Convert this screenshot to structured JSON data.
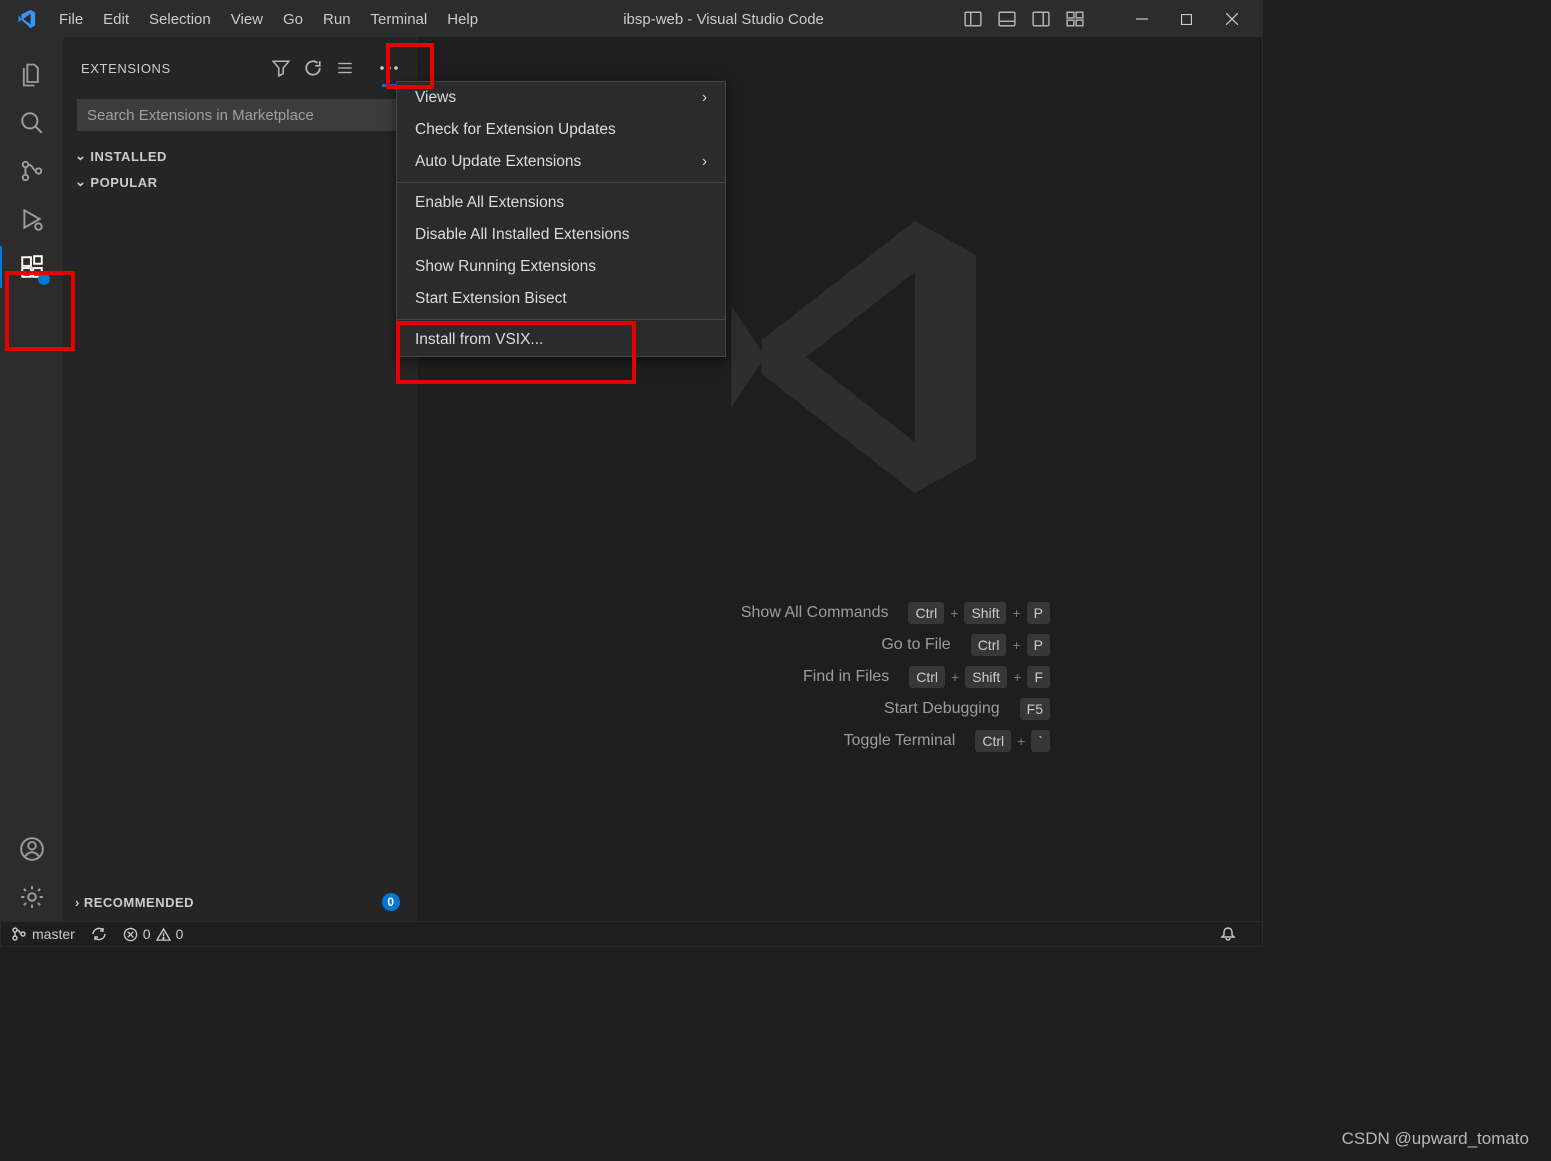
{
  "titlebar": {
    "menu": [
      "File",
      "Edit",
      "Selection",
      "View",
      "Go",
      "Run",
      "Terminal",
      "Help"
    ],
    "title": "ibsp-web - Visual Studio Code"
  },
  "sidepanel": {
    "title": "EXTENSIONS",
    "search_placeholder": "Search Extensions in Marketplace",
    "sections": {
      "installed": "INSTALLED",
      "popular": "POPULAR",
      "recommended": "RECOMMENDED",
      "recommended_count": "0"
    }
  },
  "context_menu": {
    "items": [
      {
        "label": "Views",
        "submenu": true
      },
      {
        "label": "Check for Extension Updates"
      },
      {
        "label": "Auto Update Extensions",
        "submenu": true
      }
    ],
    "group2": [
      {
        "label": "Enable All Extensions"
      },
      {
        "label": "Disable All Installed Extensions"
      },
      {
        "label": "Show Running Extensions"
      },
      {
        "label": "Start Extension Bisect"
      }
    ],
    "group3": [
      {
        "label": "Install from VSIX..."
      }
    ]
  },
  "commands": {
    "rows": [
      {
        "label": "Show All Commands",
        "keys": [
          "Ctrl",
          "+",
          "Shift",
          "+",
          "P"
        ]
      },
      {
        "label": "Go to File",
        "keys": [
          "Ctrl",
          "+",
          "P"
        ]
      },
      {
        "label": "Find in Files",
        "keys": [
          "Ctrl",
          "+",
          "Shift",
          "+",
          "F"
        ]
      },
      {
        "label": "Start Debugging",
        "keys": [
          "F5"
        ]
      },
      {
        "label": "Toggle Terminal",
        "keys": [
          "Ctrl",
          "+",
          "`"
        ]
      }
    ]
  },
  "statusbar": {
    "branch": "master",
    "errors": "0",
    "warnings": "0"
  },
  "watermark": "CSDN @upward_tomato"
}
